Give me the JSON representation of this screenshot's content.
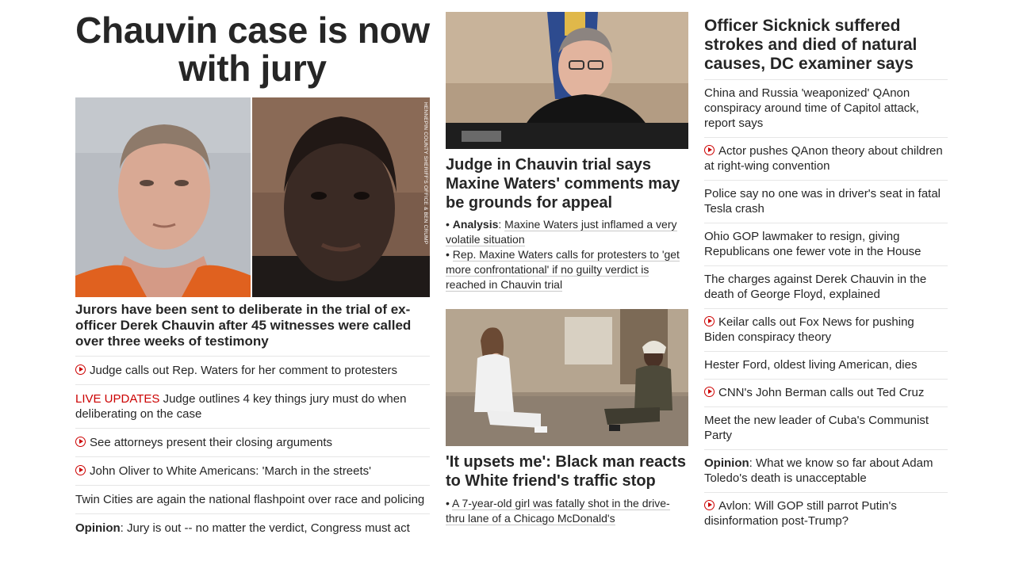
{
  "hero": {
    "title": "Chauvin case is now with jury",
    "image_credit": "HENNEPIN COUNTY SHERIFF'S OFFICE & BEN CRUMP",
    "description": "Jurors have been sent to deliberate in the trial of ex-officer Derek Chauvin after 45 witnesses were called over three weeks of testimony",
    "items": [
      {
        "type": "video",
        "text": "Judge calls out Rep. Waters for her comment to protesters"
      },
      {
        "type": "live",
        "prefix": "LIVE UPDATES",
        "text": " Judge outlines 4 key things jury must do when deliberating on the case"
      },
      {
        "type": "video",
        "text": "See attorneys present their closing arguments"
      },
      {
        "type": "video",
        "text": "John Oliver to White Americans: 'March in the streets'"
      },
      {
        "type": "plain",
        "text": "Twin Cities are again the national flashpoint over race and policing"
      },
      {
        "type": "opinion",
        "prefix": "Opinion",
        "text": ": Jury is out -- no matter the verdict, Congress must act"
      }
    ]
  },
  "middle": {
    "story1": {
      "title": "Judge in Chauvin trial says Maxine Waters' comments may be grounds for appeal",
      "bullet1_label": "Analysis",
      "bullet1_text": "Maxine Waters just inflamed a very volatile situation",
      "bullet2_text": "Rep. Maxine Waters calls for protesters to 'get more confrontational' if no guilty verdict is reached in Chauvin trial"
    },
    "story2": {
      "title": "'It upsets me': Black man reacts to White friend's traffic stop",
      "bullet1_text": "A 7-year-old girl was fatally shot in the drive-thru lane of a Chicago McDonald's"
    }
  },
  "right": {
    "title": "Officer Sicknick suffered strokes and died of natural causes, DC examiner says",
    "items": [
      {
        "type": "plain",
        "text": "China and Russia 'weaponized' QAnon conspiracy around time of Capitol attack, report says"
      },
      {
        "type": "video",
        "text": "Actor pushes QAnon theory about children at right-wing convention"
      },
      {
        "type": "plain",
        "text": "Police say no one was in driver's seat in fatal Tesla crash"
      },
      {
        "type": "plain",
        "text": "Ohio GOP lawmaker to resign, giving Republicans one fewer vote in the House"
      },
      {
        "type": "plain",
        "text": "The charges against Derek Chauvin in the death of George Floyd, explained"
      },
      {
        "type": "video",
        "text": "Keilar calls out Fox News for pushing Biden conspiracy theory"
      },
      {
        "type": "plain",
        "text": "Hester Ford, oldest living American, dies"
      },
      {
        "type": "video",
        "text": "CNN's John Berman calls out Ted Cruz"
      },
      {
        "type": "plain",
        "text": "Meet the new leader of Cuba's Communist Party"
      },
      {
        "type": "opinion",
        "prefix": "Opinion",
        "text": ": What we know so far about Adam Toledo's death is unacceptable"
      },
      {
        "type": "video",
        "text": "Avlon: Will GOP still parrot Putin's disinformation post-Trump?"
      }
    ]
  },
  "colors": {
    "accent_red": "#cc0000",
    "text": "#262626",
    "divider": "#e6e6e6"
  }
}
